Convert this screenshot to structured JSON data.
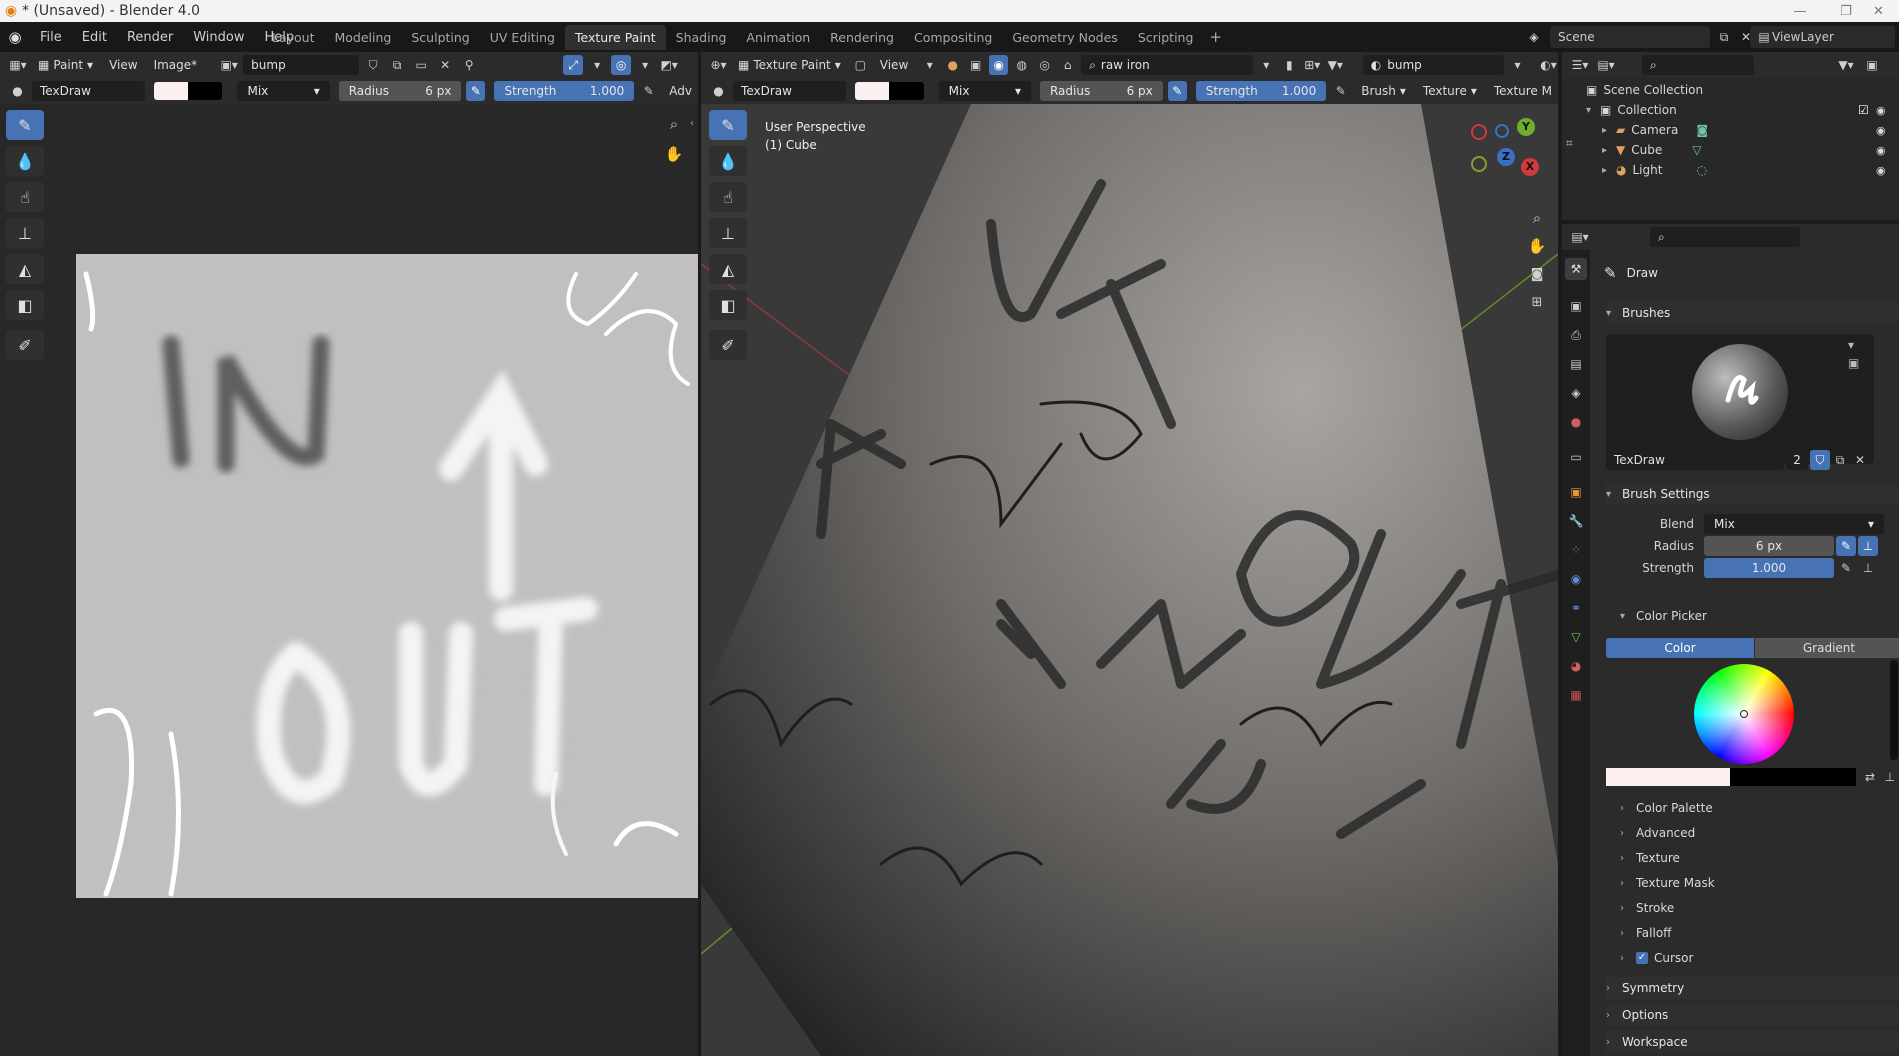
{
  "window": {
    "title": "* (Unsaved) - Blender 4.0"
  },
  "menubar": {
    "menus": [
      "File",
      "Edit",
      "Render",
      "Window",
      "Help"
    ],
    "workspaces": [
      "Layout",
      "Modeling",
      "Sculpting",
      "UV Editing",
      "Texture Paint",
      "Shading",
      "Animation",
      "Rendering",
      "Compositing",
      "Geometry Nodes",
      "Scripting"
    ],
    "active_workspace": "Texture Paint",
    "scene": "Scene",
    "view_layer": "ViewLayer"
  },
  "image_editor": {
    "mode": "Paint",
    "view": "View",
    "image_menu": "Image*",
    "image_name": "bump",
    "brush_name": "TexDraw",
    "blend": "Mix",
    "radius_label": "Radius",
    "radius_value": "6 px",
    "strength_label": "Strength",
    "strength_value": "1.000",
    "adv": "Adv",
    "texture_text": [
      "IN",
      "OUT"
    ]
  },
  "viewport": {
    "mode": "Texture Paint",
    "view": "View",
    "material_search": "raw iron",
    "image_name": "bump",
    "brush_name": "TexDraw",
    "blend": "Mix",
    "radius_label": "Radius",
    "radius_value": "6 px",
    "strength_label": "Strength",
    "strength_value": "1.000",
    "brush_menu": "Brush",
    "texture_menu": "Texture",
    "texture_mask_menu": "Texture M",
    "perspective": "User Perspective",
    "object": "(1) Cube",
    "gizmo_axes": {
      "y": "Y",
      "z": "Z",
      "x": "X"
    }
  },
  "outliner": {
    "scene_collection": "Scene Collection",
    "collection": "Collection",
    "items": [
      "Camera",
      "Cube",
      "Light"
    ]
  },
  "properties": {
    "tool_name": "Draw",
    "brushes_panel": "Brushes",
    "brush_name": "TexDraw",
    "brush_users": "2",
    "brush_settings_panel": "Brush Settings",
    "blend_label": "Blend",
    "blend_value": "Mix",
    "radius_label": "Radius",
    "radius_value": "6 px",
    "strength_label": "Strength",
    "strength_value": "1.000",
    "color_picker": "Color Picker",
    "color_tab": "Color",
    "gradient_tab": "Gradient",
    "subpanels": [
      "Color Palette",
      "Advanced",
      "Texture",
      "Texture Mask",
      "Stroke",
      "Falloff",
      "Cursor"
    ],
    "panels": [
      "Symmetry",
      "Options",
      "Workspace"
    ]
  },
  "colors": {
    "accent_blue": "#4772b3",
    "primary_color": "#fbeff0",
    "secondary_color": "#000000",
    "texture_bg": "#c1bfc2"
  }
}
